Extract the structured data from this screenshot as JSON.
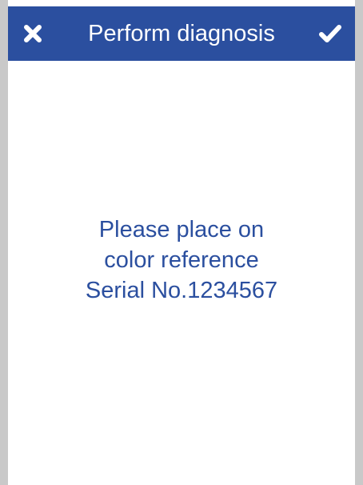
{
  "header": {
    "title": "Perform diagnosis",
    "cancel_icon": "close-icon",
    "confirm_icon": "checkmark-icon"
  },
  "message": {
    "lines": [
      "Please place on",
      "color reference",
      "Serial No.1234567"
    ]
  },
  "colors": {
    "accent": "#2b4f9f",
    "background": "#ffffff",
    "frame": "#c9c9c9"
  }
}
